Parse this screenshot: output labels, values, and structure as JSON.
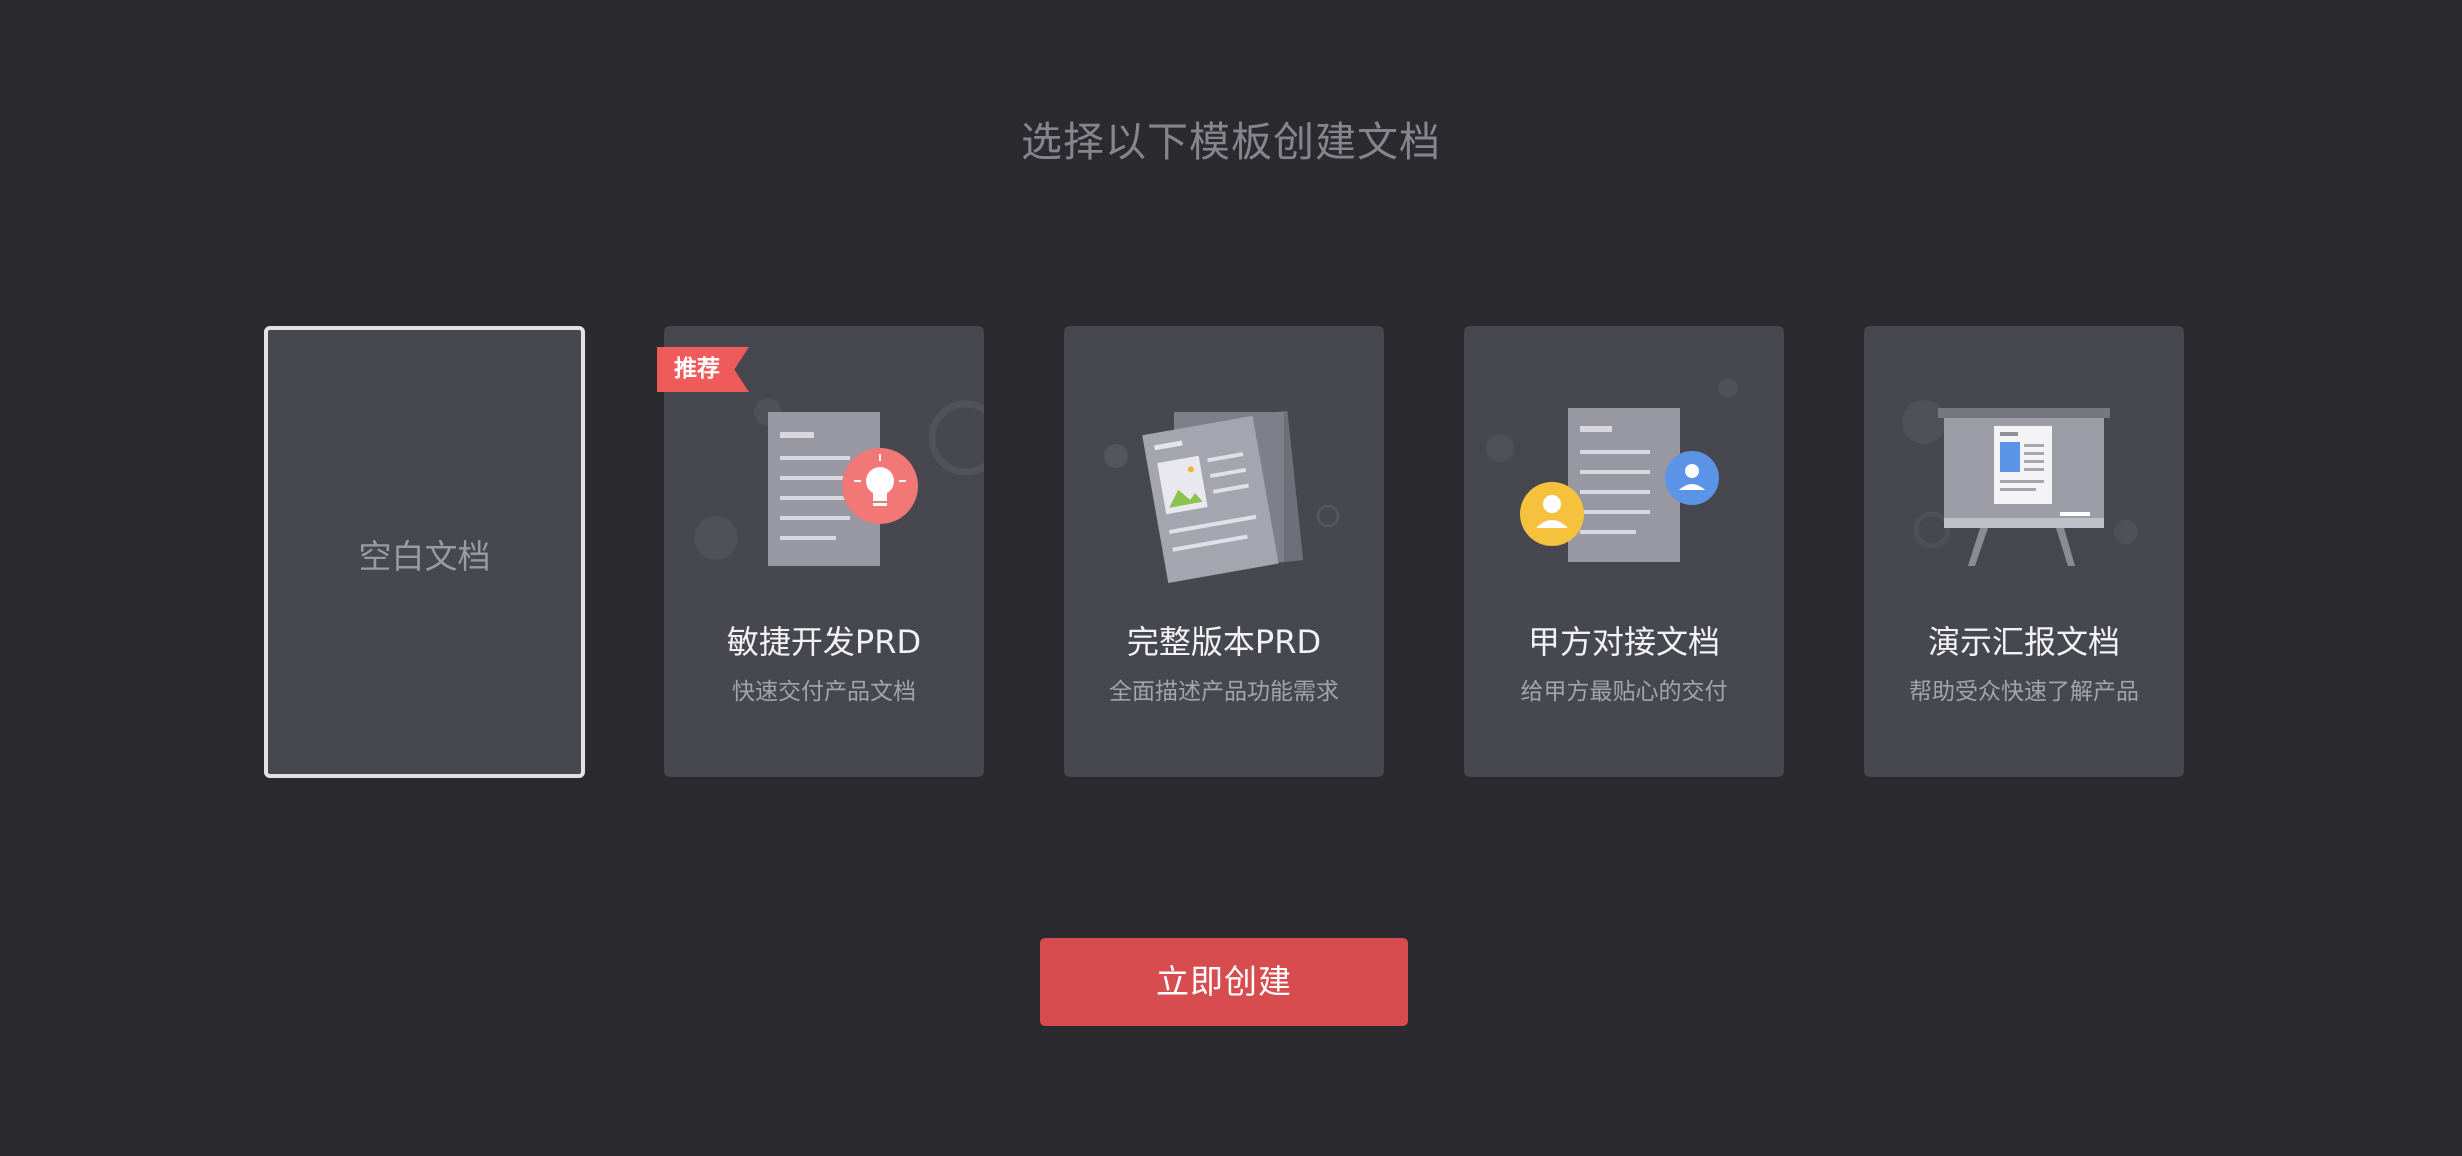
{
  "page": {
    "title": "选择以下模板创建文档"
  },
  "templates": [
    {
      "title": "空白文档",
      "selected": true
    },
    {
      "title": "敏捷开发PRD",
      "description": "快速交付产品文档",
      "badge": "推荐",
      "icon": "document-lightbulb-icon"
    },
    {
      "title": "完整版本PRD",
      "description": "全面描述产品功能需求",
      "icon": "document-stack-image-icon"
    },
    {
      "title": "甲方对接文档",
      "description": "给甲方最贴心的交付",
      "icon": "document-users-icon"
    },
    {
      "title": "演示汇报文档",
      "description": "帮助受众快速了解产品",
      "icon": "presentation-board-icon"
    }
  ],
  "actions": {
    "create_label": "立即创建"
  },
  "colors": {
    "background": "#2a2a2f",
    "card": "#47474f",
    "accent": "#d74c4f",
    "badge": "#ef5b5b",
    "selected_border": "#e2e2e6"
  }
}
